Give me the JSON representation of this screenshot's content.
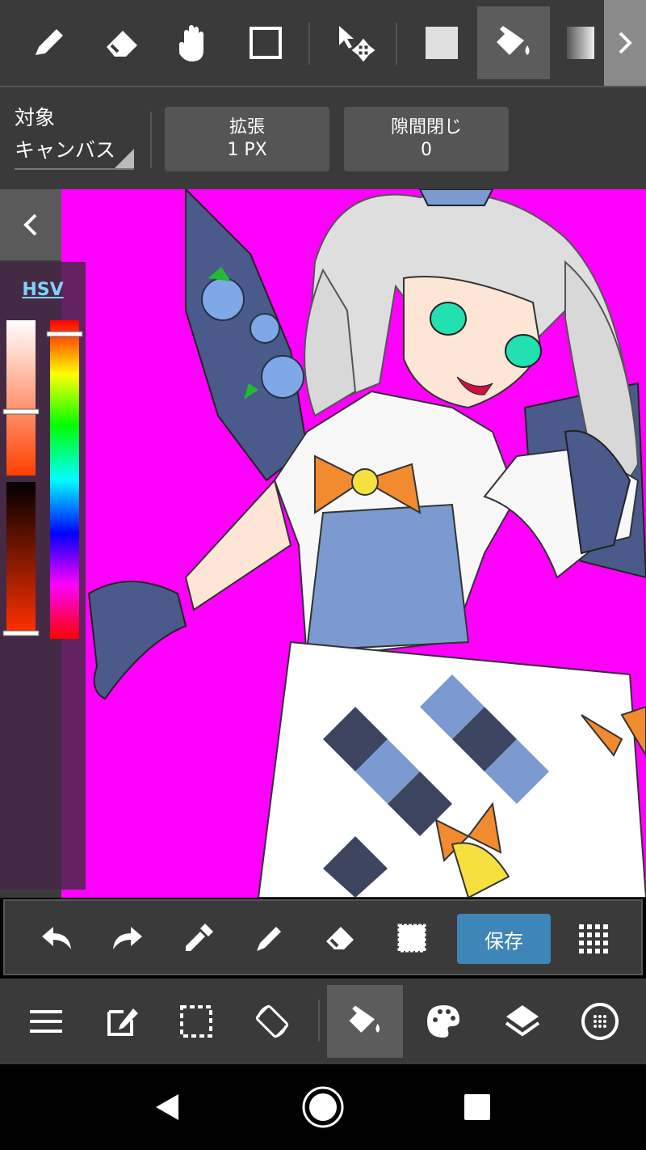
{
  "top_toolbar": {
    "tools": [
      "pen-icon",
      "eraser-icon",
      "hand-icon",
      "rectangle-icon",
      "select-move-icon",
      "fill-color-icon",
      "bucket-icon",
      "gradient-icon"
    ],
    "active_tool": "bucket-icon"
  },
  "options": {
    "target_label": "対象",
    "target_value": "キャンバス",
    "expand_title": "拡張",
    "expand_value": "1 PX",
    "gap_title": "隙間閉じ",
    "gap_value": "0"
  },
  "color_panel": {
    "mode": "HSV"
  },
  "edit_toolbar": {
    "save_label": "保存"
  },
  "main_toolbar": {
    "active": "bucket-icon"
  },
  "colors": {
    "canvas_bg": "#ff00ff",
    "save_button": "#3e86b8",
    "toolbar_bg": "#3a3a3a"
  }
}
